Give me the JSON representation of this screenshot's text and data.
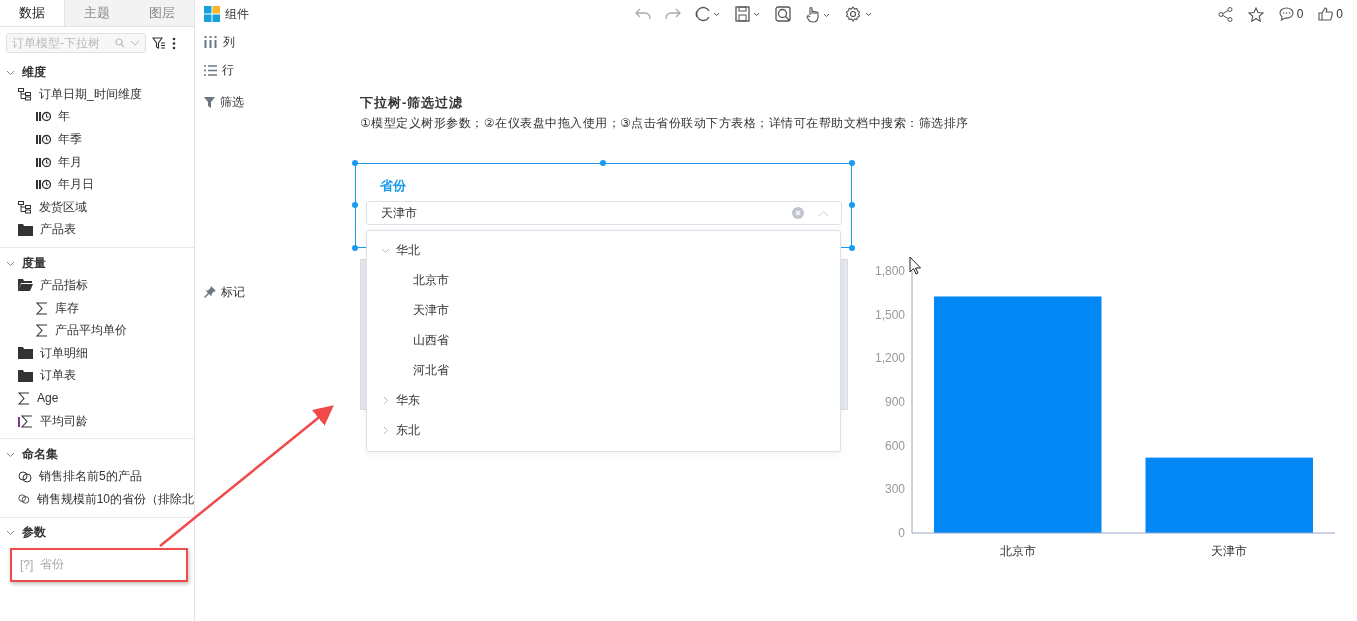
{
  "sidebar": {
    "tabs": [
      {
        "label": "数据",
        "selected": true
      },
      {
        "label": "主题",
        "selected": false
      },
      {
        "label": "图层",
        "selected": false
      }
    ],
    "model_select": {
      "value": "订单模型-下拉树"
    },
    "sections": [
      {
        "title": "维度",
        "expanded": true,
        "items": [
          {
            "label": "订单日期_时间维度",
            "kind": "hierarchy",
            "children": [
              {
                "label": "年",
                "kind": "time"
              },
              {
                "label": "年季",
                "kind": "time"
              },
              {
                "label": "年月",
                "kind": "time"
              },
              {
                "label": "年月日",
                "kind": "time"
              }
            ]
          },
          {
            "label": "发货区域",
            "kind": "hierarchy"
          },
          {
            "label": "产品表",
            "kind": "folder"
          }
        ]
      },
      {
        "title": "度量",
        "expanded": true,
        "items": [
          {
            "label": "产品指标",
            "kind": "folder-open",
            "children": [
              {
                "label": "库存",
                "kind": "measure"
              },
              {
                "label": "产品平均单价",
                "kind": "measure"
              }
            ]
          },
          {
            "label": "订单明细",
            "kind": "folder"
          },
          {
            "label": "订单表",
            "kind": "folder"
          },
          {
            "label": "Age",
            "kind": "measure"
          },
          {
            "label": "平均司龄",
            "kind": "calc-measure"
          }
        ]
      },
      {
        "title": "命名集",
        "expanded": true,
        "items": [
          {
            "label": "销售排名前5的产品",
            "kind": "named-set"
          },
          {
            "label": "销售规模前10的省份（排除北",
            "kind": "named-set"
          }
        ]
      },
      {
        "title": "参数",
        "expanded": true,
        "items": [
          {
            "label": "省份",
            "kind": "parameter",
            "icon_text": "[?]",
            "highlighted": true
          }
        ]
      }
    ]
  },
  "field_panel": [
    {
      "label": "组件",
      "kind": "components"
    },
    {
      "label": "列",
      "kind": "columns"
    },
    {
      "label": "行",
      "kind": "rows"
    },
    {
      "label": "筛选",
      "kind": "filter"
    },
    {
      "label": "标记",
      "kind": "marks"
    }
  ],
  "toolbar": {
    "comments": "0",
    "likes": "0"
  },
  "board": {
    "title": "下拉树-筛选过滤",
    "description": "①模型定义树形参数；②在仪表盘中拖入使用；③点击省份联动下方表格；详情可在帮助文档中搜索：筛选排序",
    "filter_widget": {
      "label": "省份",
      "value": "天津市",
      "open": true,
      "tree": [
        {
          "label": "华北",
          "expanded": true,
          "children": [
            {
              "label": "北京市"
            },
            {
              "label": "天津市"
            },
            {
              "label": "山西省"
            },
            {
              "label": "河北省"
            }
          ]
        },
        {
          "label": "华东",
          "expanded": false
        },
        {
          "label": "东北",
          "expanded": false
        }
      ]
    },
    "chart_data": {
      "type": "bar",
      "categories": [
        "北京市",
        "天津市"
      ],
      "series": [
        {
          "color": "#0389f5",
          "values": [
            1625,
            518
          ]
        }
      ],
      "ylim": [
        0,
        1800
      ],
      "yticks": [
        {
          "value": 0,
          "label": "0"
        },
        {
          "value": 300,
          "label": "300"
        },
        {
          "value": 600,
          "label": "600"
        },
        {
          "value": 900,
          "label": "900"
        },
        {
          "value": 1200,
          "label": "1,200"
        },
        {
          "value": 1500,
          "label": "1,500"
        },
        {
          "value": 1800,
          "label": "1,800"
        }
      ]
    }
  }
}
